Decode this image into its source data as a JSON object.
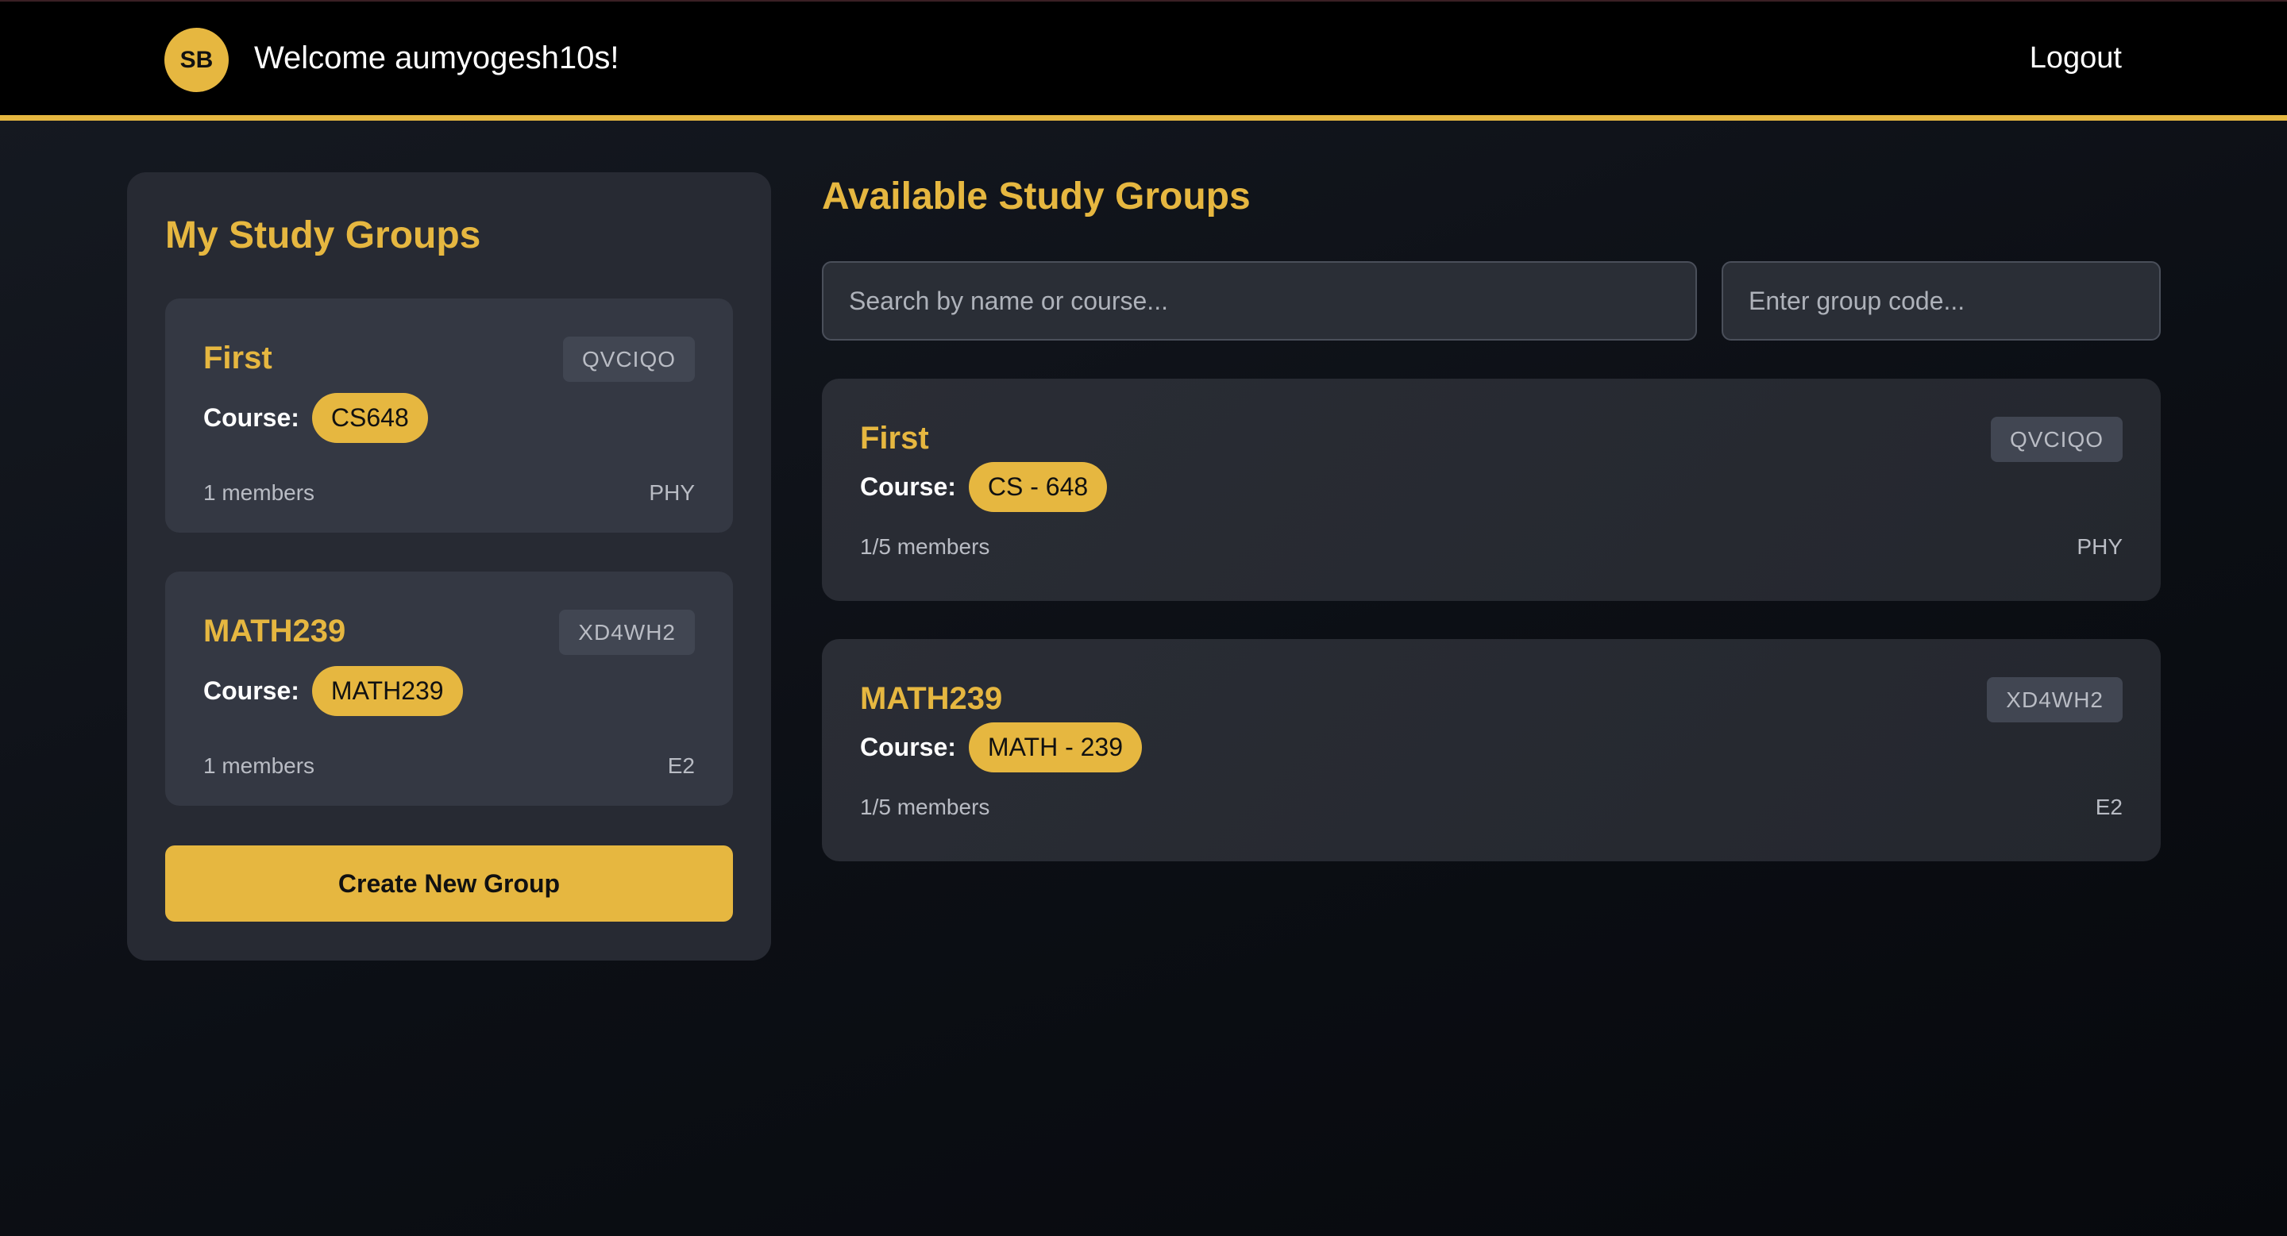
{
  "header": {
    "avatar_initials": "SB",
    "welcome_text": "Welcome aumyogesh10s!",
    "logout_label": "Logout"
  },
  "my_groups": {
    "title": "My Study Groups",
    "groups": [
      {
        "name": "First",
        "code": "QVCIQO",
        "course_label": "Course:",
        "course": "CS648",
        "members": "1 members",
        "location": "PHY"
      },
      {
        "name": "MATH239",
        "code": "XD4WH2",
        "course_label": "Course:",
        "course": "MATH239",
        "members": "1 members",
        "location": "E2"
      }
    ],
    "create_button_label": "Create New Group"
  },
  "available": {
    "title": "Available Study Groups",
    "search_placeholder": "Search by name or course...",
    "code_placeholder": "Enter group code...",
    "groups": [
      {
        "name": "First",
        "code": "QVCIQO",
        "course_label": "Course:",
        "course": "CS - 648",
        "members": "1/5 members",
        "location": "PHY"
      },
      {
        "name": "MATH239",
        "code": "XD4WH2",
        "course_label": "Course:",
        "course": "MATH - 239",
        "members": "1/5 members",
        "location": "E2"
      }
    ]
  },
  "colors": {
    "accent": "#e6b740",
    "panel": "#272a33",
    "card": "#343843",
    "header_bg": "#000000"
  }
}
